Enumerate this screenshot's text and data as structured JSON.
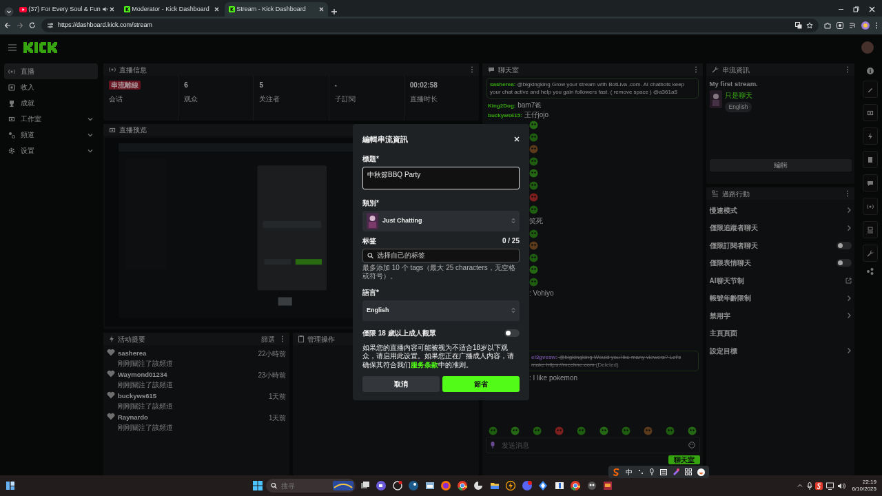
{
  "browser": {
    "tabs": [
      {
        "title": "(37) For Every Soul & Fun",
        "kind": "video",
        "audio": true,
        "selected": false
      },
      {
        "title": "Moderator - Kick Dashboard",
        "kind": "kick",
        "audio": false,
        "selected": false
      },
      {
        "title": "Stream - Kick Dashboard",
        "kind": "kick",
        "audio": false,
        "selected": true
      }
    ],
    "url": "https://dashboard.kick.com/stream"
  },
  "sidebar": {
    "items": [
      {
        "label": "直播",
        "expandable": false,
        "selected": true
      },
      {
        "label": "收入",
        "expandable": false,
        "selected": false
      },
      {
        "label": "成就",
        "expandable": false,
        "selected": false
      },
      {
        "label": "工作室",
        "expandable": true,
        "selected": false
      },
      {
        "label": "頻道",
        "expandable": true,
        "selected": false
      },
      {
        "label": "设置",
        "expandable": true,
        "selected": false
      }
    ]
  },
  "stream_info": {
    "title": "直播信息",
    "stats": [
      {
        "badge": "串流離線",
        "label": "会话"
      },
      {
        "value": "6",
        "label": "观众"
      },
      {
        "value": "5",
        "label": "关注者"
      },
      {
        "value": "-",
        "label": "子訂閱"
      },
      {
        "value": "00:02:58",
        "label": "直播时长"
      }
    ]
  },
  "preview": {
    "title": "直播预览"
  },
  "activity": {
    "title": "活动提要",
    "filter": "篩選",
    "items": [
      {
        "user": "sasherea",
        "text": "刚刚關注了該頻道",
        "time": "22小時前"
      },
      {
        "user": "Waymond01234",
        "text": "刚刚關注了該頻道",
        "time": "23小時前"
      },
      {
        "user": "buckyws615",
        "text": "刚刚關注了該頻道",
        "time": "1天前"
      },
      {
        "user": "Raynardo",
        "text": "刚刚關注了該頻道",
        "time": "1天前"
      }
    ]
  },
  "mod_actions": {
    "title": "管理操作"
  },
  "chat": {
    "title": "聊天室",
    "messages": [
      {
        "kind": "highlight",
        "user": "sasherea:",
        "text": "@bigkingking Grow your stream with BotLiva .com. AI chatbots keep your chat active and help you gain followers fast. ( remove space ) @a361a5"
      },
      {
        "kind": "text",
        "user": "King2Dog:",
        "text": "bam7爸"
      },
      {
        "kind": "text",
        "user": "buckyws615:",
        "text": "王仔jojo"
      },
      {
        "kind": "emote"
      },
      {
        "kind": "emote"
      },
      {
        "kind": "emote"
      },
      {
        "kind": "emote"
      },
      {
        "kind": "emote"
      },
      {
        "kind": "emote"
      },
      {
        "kind": "emote"
      },
      {
        "kind": "emote"
      },
      {
        "kind": "fragment",
        "text": "笑死"
      },
      {
        "kind": "emote"
      },
      {
        "kind": "emote"
      },
      {
        "kind": "emote"
      },
      {
        "kind": "emote"
      },
      {
        "kind": "emote"
      },
      {
        "kind": "fragment",
        "text": ": Vohiyo"
      },
      {
        "kind": "spacer"
      },
      {
        "kind": "spacer"
      },
      {
        "kind": "spacer"
      },
      {
        "kind": "spacer"
      },
      {
        "kind": "deleted",
        "user": "el3gvesw:",
        "text": "@bigkingking Would you like many viewers? Let's make",
        "link": "https://mechne.com",
        "note": "(Deleted)"
      },
      {
        "kind": "fragment",
        "text": ": I like pokemon"
      }
    ],
    "input_placeholder": "发送消息",
    "send": "聊天室"
  },
  "stream_card": {
    "title": "串流資訊",
    "stream_title": "My first stream.",
    "category": "只是聊天",
    "language": "English",
    "edit": "編輯"
  },
  "chat_actions": {
    "title": "過路行動",
    "items": [
      {
        "label": "慢速模式",
        "kind": "link"
      },
      {
        "label": "僅限追蹤者聊天",
        "kind": "link"
      },
      {
        "label": "僅限訂閱者聊天",
        "kind": "toggle",
        "on": false
      },
      {
        "label": "僅限表情聊天",
        "kind": "toggle",
        "on": false
      },
      {
        "label": "AI聊天节制",
        "kind": "external"
      },
      {
        "label": "帳號年齡限制",
        "kind": "link"
      },
      {
        "label": "禁用字",
        "kind": "link"
      },
      {
        "label": "主頁頁面",
        "kind": "plain"
      },
      {
        "label": "設定目標",
        "kind": "link"
      }
    ]
  },
  "modal": {
    "title": "編輯串流資訊",
    "title_label": "標題*",
    "title_value": "中秋節BBQ Party",
    "category_label": "類別*",
    "category_value": "Just Chatting",
    "tags_label": "标签",
    "tags_count": "0 / 25",
    "tags_placeholder": "选择自己的标签",
    "tags_hint": "最多添加 10 个 tags（最大 25 characters，无空格或符号）。",
    "language_label": "語言*",
    "language_value": "English",
    "mature_label": "僅限 18 歲以上成人觀眾",
    "mature_on": false,
    "mature_note_before": "如果您的直播内容可能被视为不适合18岁以下观众，请启用此设置。如果您正在广播成人内容，请确保其符合我们",
    "mature_note_link": "服务条款",
    "mature_note_after": "中的准则。",
    "cancel": "取消",
    "save": "節省"
  },
  "ime_bar": {
    "mode": "中"
  },
  "taskbar": {
    "search_placeholder": "搜寻",
    "time": "22:19",
    "date": "6/10/2025"
  }
}
